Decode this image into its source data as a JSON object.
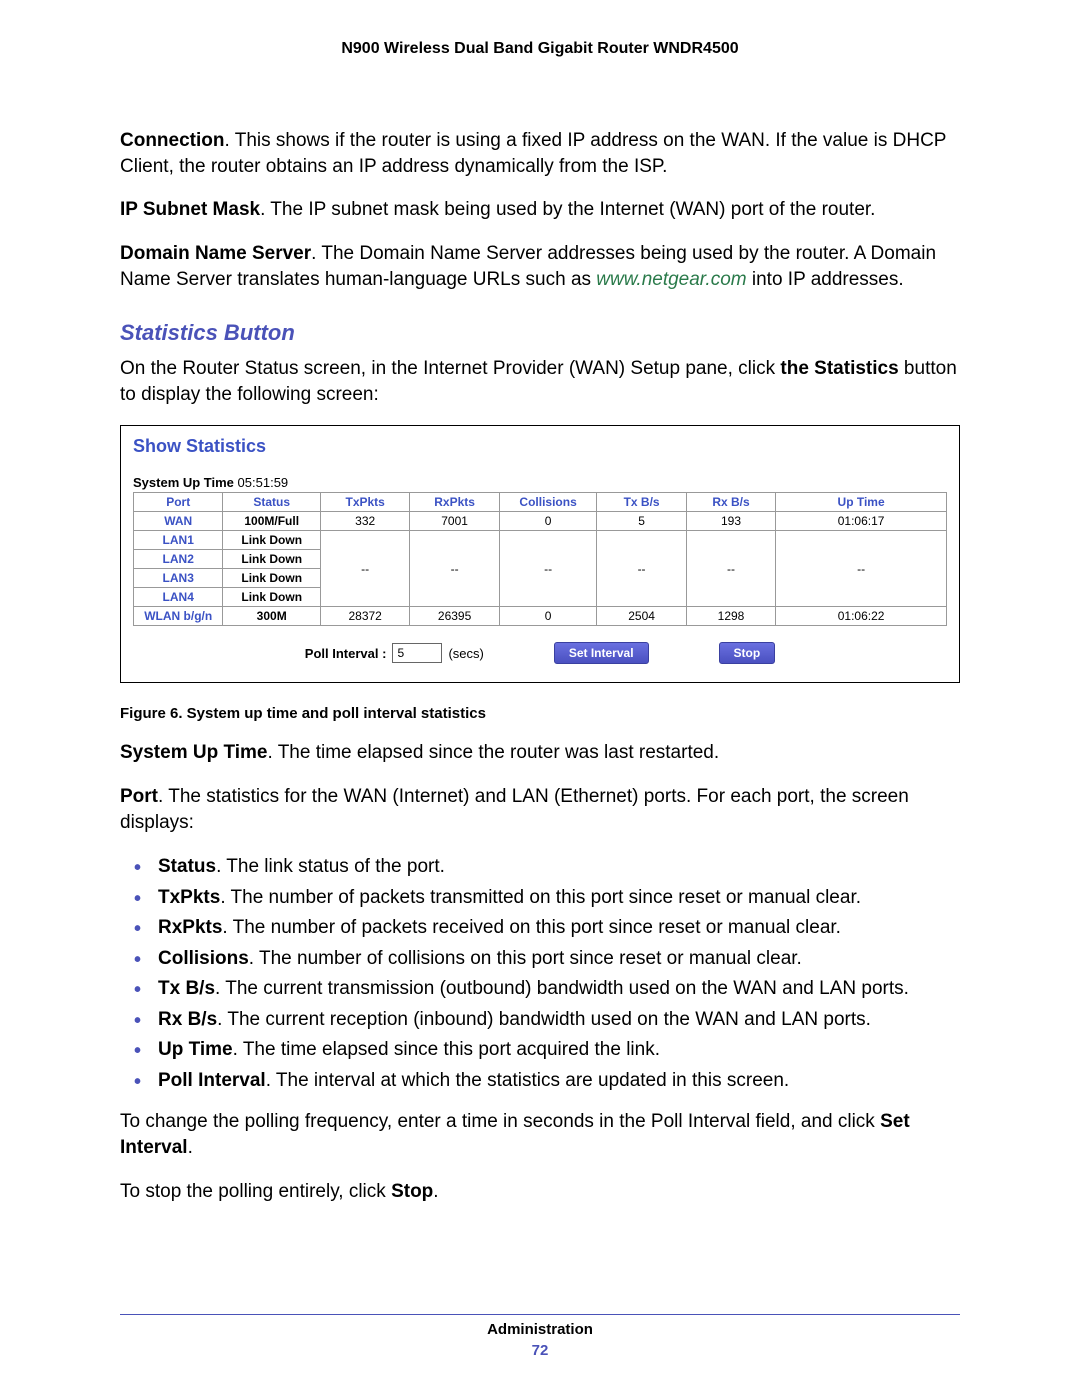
{
  "header": "N900 Wireless Dual Band Gigabit Router WNDR4500",
  "p_conn_label": "Connection",
  "p_conn_rest": ". This shows if the router is using a fixed IP address on the WAN. If the value is DHCP Client, the router obtains an IP address dynamically from the ISP.",
  "p_ip_label": "IP Subnet Mask",
  "p_ip_rest": ". The IP subnet mask being used by the Internet (WAN) port of the router.",
  "p_dns_label": "Domain Name Server",
  "p_dns_rest1": ". The Domain Name Server addresses being used by the router. A Domain Name Server translates human-language URLs such as ",
  "p_dns_link": "www.netgear.com",
  "p_dns_rest2": " into IP addresses.",
  "section_title": "Statistics Button",
  "p_intro1": "On the Router Status screen, in the Internet Provider (WAN) Setup pane, click ",
  "p_intro_bold": "the Statistics",
  "p_intro2": " button to display the following screen:",
  "panel": {
    "title": "Show Statistics",
    "sysup_label": "System Up Time",
    "sysup_value": "05:51:59",
    "headers": [
      "Port",
      "Status",
      "TxPkts",
      "RxPkts",
      "Collisions",
      "Tx B/s",
      "Rx B/s",
      "Up Time"
    ],
    "rows": [
      {
        "port": "WAN",
        "status": "100M/Full",
        "tx": "332",
        "rx": "7001",
        "col": "0",
        "txbs": "5",
        "rxbs": "193",
        "up": "01:06:17"
      },
      {
        "port": "LAN1",
        "status": "Link Down",
        "is_lan_group": "first"
      },
      {
        "port": "LAN2",
        "status": "Link Down",
        "is_lan_group": "mid"
      },
      {
        "port": "LAN3",
        "status": "Link Down",
        "is_lan_group": "mid"
      },
      {
        "port": "LAN4",
        "status": "Link Down",
        "is_lan_group": "last"
      },
      {
        "port": "WLAN b/g/n",
        "status": "300M",
        "tx": "28372",
        "rx": "26395",
        "col": "0",
        "txbs": "2504",
        "rxbs": "1298",
        "up": "01:06:22"
      }
    ],
    "lan_dash": "--",
    "poll_label": "Poll Interval :",
    "poll_value": "5",
    "poll_unit": "(secs)",
    "btn_set": "Set Interval",
    "btn_stop": "Stop"
  },
  "figcap": "Figure 6. System up time and poll interval statistics",
  "p_sysup_label": "System Up Time",
  "p_sysup_rest": ". The time elapsed since the router was last restarted.",
  "p_port_label": "Port",
  "p_port_rest": ". The statistics for the WAN (Internet) and LAN (Ethernet) ports. For each port, the screen displays:",
  "bullets": [
    {
      "b": "Status",
      "r": ". The link status of the port."
    },
    {
      "b": "TxPkts",
      "r": ". The number of packets transmitted on this port since reset or manual clear."
    },
    {
      "b": "RxPkts",
      "r": ". The number of packets received on this port since reset or manual clear."
    },
    {
      "b": "Collisions",
      "r": ". The number of collisions on this port since reset or manual clear."
    },
    {
      "b": "Tx B/s",
      "r": ". The current transmission (outbound) bandwidth used on the WAN and LAN ports."
    },
    {
      "b": "Rx B/s",
      "r": ". The current reception (inbound) bandwidth used on the WAN and LAN ports."
    },
    {
      "b": "Up Time",
      "r": ". The time elapsed since this port acquired the link."
    },
    {
      "b": "Poll Interval",
      "r": ". The interval at which the statistics are updated in this screen."
    }
  ],
  "p_change1": "To change the polling frequency, enter a time in seconds in the Poll Interval field, and click ",
  "p_change_bold": "Set Interval",
  "p_change2": ".",
  "p_stop1": "To stop the polling entirely, click ",
  "p_stop_bold": "Stop",
  "p_stop2": ".",
  "footer_section": "Administration",
  "footer_page": "72"
}
